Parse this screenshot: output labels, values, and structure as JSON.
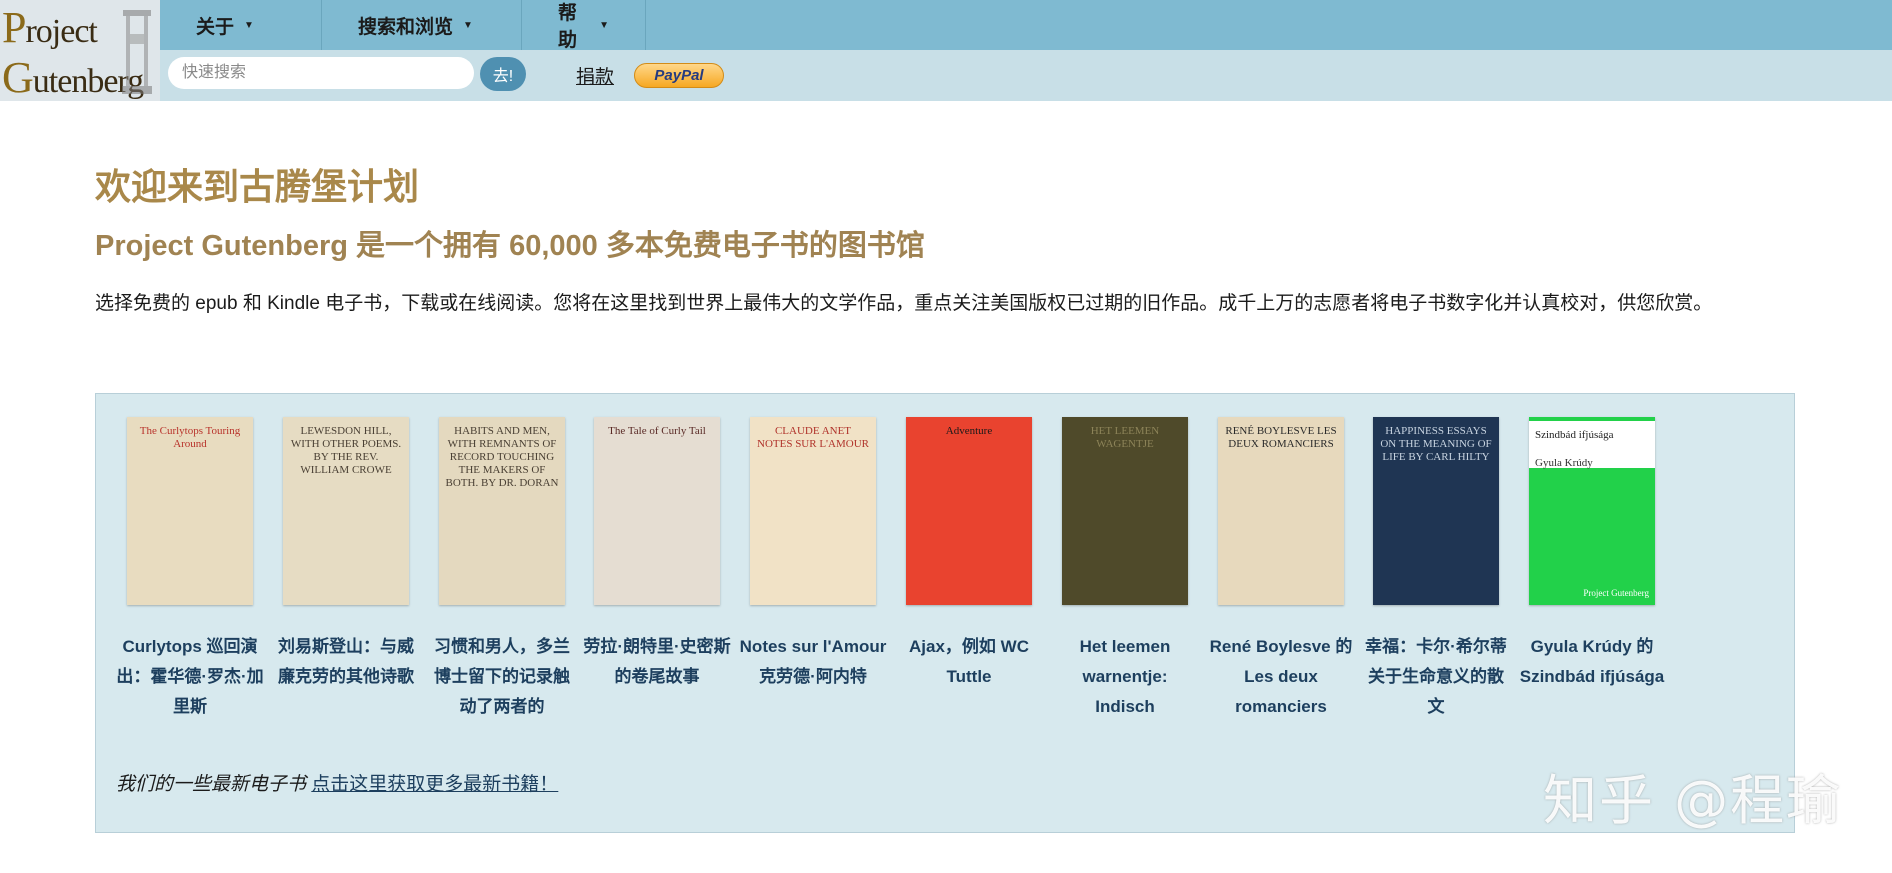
{
  "logo": {
    "line1_cap": "P",
    "line1_rest": "roject",
    "line2_cap": "G",
    "line2_rest": "utenberg"
  },
  "nav": {
    "menus": [
      {
        "label": "关于"
      },
      {
        "label": "搜索和浏览"
      },
      {
        "label": "帮助"
      }
    ],
    "search_placeholder": "快速搜索",
    "go_label": "去!",
    "donate_label": "捐款",
    "paypal_label": "PayPal"
  },
  "main": {
    "title": "欢迎来到古腾堡计划",
    "subtitle": "Project Gutenberg 是一个拥有 60,000 多本免费电子书的图书馆",
    "intro": "选择免费的 epub 和 Kindle 电子书，下载或在线阅读。您将在这里找到世界上最伟大的文学作品，重点关注美国版权已过期的旧作品。成千上万的志愿者将电子书数字化并认真校对，供您欣赏。"
  },
  "books": [
    {
      "label": "Curlytops 巡回演出：霍华德·罗杰·加里斯",
      "cover_text": "The Curlytops Touring Around",
      "bg": "#e8dcc0",
      "fg": "#b8332b"
    },
    {
      "label": "刘易斯登山：与威廉克劳的其他诗歌",
      "cover_text": "LEWESDON HILL, WITH OTHER POEMS. BY THE REV. WILLIAM CROWE",
      "bg": "#e6dcc3",
      "fg": "#4a4034"
    },
    {
      "label": "习惯和男人，多兰博士留下的记录触动了两者的",
      "cover_text": "HABITS AND MEN, WITH REMNANTS OF RECORD TOUCHING THE MAKERS OF BOTH. BY DR. DORAN",
      "bg": "#e4d9bf",
      "fg": "#4a4034"
    },
    {
      "label": "劳拉·朗特里·史密斯的卷尾故事",
      "cover_text": "The Tale of Curly Tail",
      "bg": "#e5ddd2",
      "fg": "#5a2a26"
    },
    {
      "label": "Notes sur l'Amour 克劳德·阿内特",
      "cover_text": "CLAUDE ANET NOTES SUR L'AMOUR",
      "bg": "#f1e2c6",
      "fg": "#b0322a"
    },
    {
      "label": "Ajax，例如 WC Tuttle",
      "cover_text": "Adventure",
      "bg": "#e9432f",
      "fg": "#1a1a1a"
    },
    {
      "label": "Het leemen warnentje: Indisch",
      "cover_text": "HET LEEMEN WAGENTJE",
      "bg": "#4f4a2a",
      "fg": "#8c8358"
    },
    {
      "label": "René Boylesve 的 Les deux romanciers",
      "cover_text": "RENÉ BOYLESVE LES DEUX ROMANCIERS",
      "bg": "#e7d9bd",
      "fg": "#2a2a2a"
    },
    {
      "label": "幸福：卡尔·希尔蒂关于生命意义的散文",
      "cover_text": "HAPPINESS ESSAYS ON THE MEANING OF LIFE BY CARL HILTY",
      "bg": "#1f3553",
      "fg": "#c7d3e0"
    },
    {
      "label": "Gyula Krúdy 的 Szindbád ifjúsága",
      "cover_text": "Szindbád ifjúsága",
      "cover_sub": "Gyula Krúdy",
      "cover_badge": "Project Gutenberg",
      "bg": "#22d14a",
      "fg": "#1a2a8a"
    }
  ],
  "latest": {
    "text": "我们的一些最新电子书",
    "link": "点击这里获取更多最新书籍！"
  },
  "watermark": "知乎 @程瑜"
}
